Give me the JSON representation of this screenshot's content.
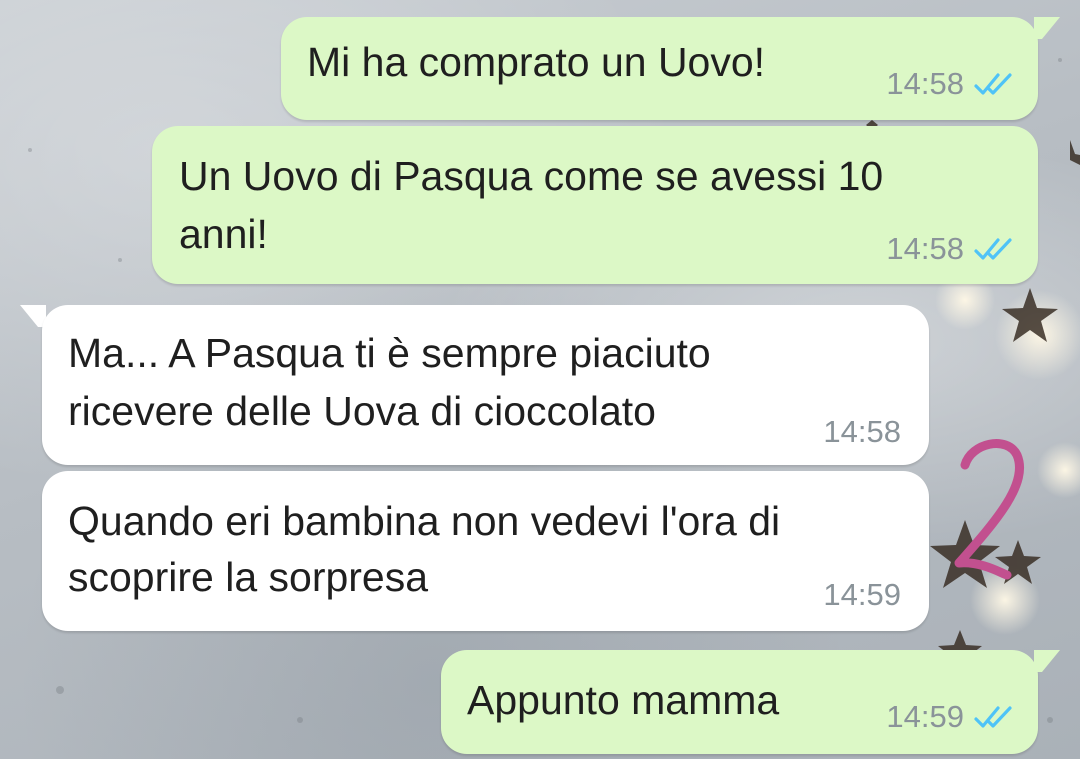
{
  "colors": {
    "outgoing_bubble": "#dcf8c6",
    "incoming_bubble": "#ffffff",
    "read_ticks": "#4fc3f7",
    "timestamp": "#8a9399",
    "annotation": "#c2508f"
  },
  "messages": [
    {
      "direction": "outgoing",
      "lines": [
        "Mi ha comprato un Uovo!"
      ],
      "time": "14:58",
      "status": "read"
    },
    {
      "direction": "outgoing",
      "lines": [
        "Un Uovo di Pasqua come se avessi 10",
        "anni!"
      ],
      "time": "14:58",
      "status": "read"
    },
    {
      "direction": "incoming",
      "lines": [
        "Ma... A Pasqua ti è sempre piaciuto",
        "ricevere delle Uova di cioccolato"
      ],
      "time": "14:58"
    },
    {
      "direction": "incoming",
      "lines": [
        "Quando eri bambina non vedevi l'ora di",
        "scoprire la sorpresa"
      ],
      "time": "14:59"
    },
    {
      "direction": "outgoing",
      "lines": [
        "Appunto mamma"
      ],
      "time": "14:59",
      "status": "read"
    }
  ],
  "annotation": {
    "text": "2",
    "icon": "handwritten-digit"
  }
}
